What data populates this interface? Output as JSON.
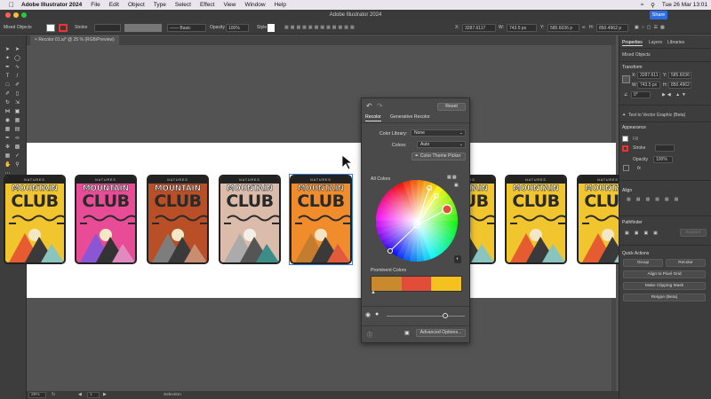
{
  "menubar": {
    "items": [
      "Adobe Illustrator 2024",
      "File",
      "Edit",
      "Object",
      "Type",
      "Select",
      "Effect",
      "View",
      "Window",
      "Help"
    ],
    "clock": "Tue 26 Mar  13:01"
  },
  "window": {
    "title": "Adobe Illustrator 2024",
    "share_label": "Share"
  },
  "control_bar": {
    "selection": "Mixed Objects",
    "stroke_label": "Stroke",
    "brush_label": "Basic",
    "opacity_label": "Opacity",
    "opacity_value": "100%",
    "style_label": "Style",
    "x_value": "3287.6117",
    "w_value": "743.5 px",
    "y_value": "585.6036 p",
    "h_value": "850.4962 p"
  },
  "document_tab": {
    "label": "Recolor 01.ai* @ 25 % (RGB/Preview)",
    "close": "×"
  },
  "status": {
    "zoom": "25%",
    "page": "1",
    "tool": "Selection"
  },
  "badges": {
    "natures": "NATURES",
    "mountain": "MOUNTAIN",
    "club": "CLUB",
    "items": [
      {
        "bg": "#f1c52e",
        "text": "#2a2a2a",
        "sun": "#f3e7c5",
        "m1": "#e65b2f",
        "m2": "#3a3a3a",
        "m3": "#8ac4bf"
      },
      {
        "bg": "#e94c97",
        "text": "#2a2a2a",
        "sun": "#f3e7c5",
        "m1": "#8b56d6",
        "m2": "#333333",
        "m3": "#e28ac0"
      },
      {
        "bg": "#b84f27",
        "text": "#2a2a2a",
        "sun": "#f3e7c5",
        "m1": "#7d7d7d",
        "m2": "#3a3a3a",
        "m3": "#c98d6f"
      },
      {
        "bg": "#dbbcaa",
        "text": "#2a2a2a",
        "sun": "#f3eee6",
        "m1": "#ababab",
        "m2": "#555555",
        "m3": "#3c8d87"
      },
      {
        "bg": "#f08c2c",
        "text": "#2a2a2a",
        "sun": "#f7e4c2",
        "m1": "#c47d2e",
        "m2": "#3a3a3a",
        "m3": "#e35a3a",
        "mt_text": "#f4e9d8"
      },
      {
        "bg": "#f1c52e",
        "text": "#2a2a2a",
        "sun": "#f3e7c5",
        "m1": "#e65b2f",
        "m2": "#3a3a3a",
        "m3": "#8ac4bf"
      },
      {
        "bg": "#f1c52e",
        "text": "#2a2a2a",
        "sun": "#f3e7c5",
        "m1": "#e65b2f",
        "m2": "#3a3a3a",
        "m3": "#8ac4bf"
      },
      {
        "bg": "#f1c52e",
        "text": "#2a2a2a",
        "sun": "#f3e7c5",
        "m1": "#e65b2f",
        "m2": "#3a3a3a",
        "m3": "#8ac4bf"
      }
    ]
  },
  "recolor": {
    "reset_label": "Reset",
    "tabs": [
      "Recolor",
      "Generative Recolor"
    ],
    "color_library_label": "Color Library:",
    "color_library_value": "None",
    "colors_label": "Colors:",
    "colors_value": "Auto",
    "theme_picker_label": "Color Theme Picker",
    "all_colors_label": "All Colors",
    "prominent_label": "Prominent Colors",
    "prominent_swatches": [
      "#c98a2e",
      "#e24d3a",
      "#f4c21f"
    ],
    "advanced_label": "Advanced Options..."
  },
  "properties": {
    "tabs": [
      "Properties",
      "Layers",
      "Libraries"
    ],
    "selection": "Mixed Objects",
    "transform_title": "Transform",
    "x_label": "X:",
    "x_value": "3287.611",
    "y_label": "Y:",
    "y_value": "585.6036",
    "w_label": "W:",
    "w_value": "743.5 px",
    "h_label": "H:",
    "h_value": "850.4962",
    "angle_value": "0°",
    "text_to_vector": "Text to Vector Graphic (Beta)",
    "appearance_title": "Appearance",
    "fill_label": "Fill",
    "stroke_label": "Stroke",
    "opacity_label": "Opacity",
    "opacity_value": "100%",
    "fx_label": "fx",
    "align_title": "Align",
    "pathfinder_title": "Pathfinder",
    "expand_label": "Expand",
    "quick_actions_title": "Quick Actions",
    "group_label": "Group",
    "recolor_label": "Recolor",
    "align_pixel_label": "Align to Pixel Grid",
    "clipping_label": "Make Clipping Mask",
    "retype_label": "Retype (Beta)"
  }
}
